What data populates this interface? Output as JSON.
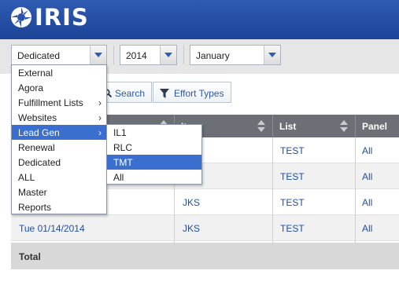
{
  "app": {
    "logo_text": "IRIS"
  },
  "filters": {
    "type": {
      "value": "Dedicated"
    },
    "year": {
      "value": "2014"
    },
    "month": {
      "value": "January"
    }
  },
  "toolbar": {
    "search_label": "Search",
    "effort_types_label": "Effort Types"
  },
  "menu": {
    "items": [
      {
        "label": "External",
        "submenu": false
      },
      {
        "label": "Agora",
        "submenu": false
      },
      {
        "label": "Fulfillment Lists",
        "submenu": true
      },
      {
        "label": "Websites",
        "submenu": true
      },
      {
        "label": "Lead Gen",
        "submenu": true,
        "highlighted": true
      },
      {
        "label": "Renewal",
        "submenu": false
      },
      {
        "label": "Dedicated",
        "submenu": false
      },
      {
        "label": "ALL",
        "submenu": false
      },
      {
        "label": "Master",
        "submenu": false
      },
      {
        "label": "Reports",
        "submenu": false
      }
    ],
    "chevron": "›"
  },
  "submenu": {
    "items": [
      {
        "label": "IL1"
      },
      {
        "label": "RLC"
      },
      {
        "label": "TMT",
        "highlighted": true
      },
      {
        "label": "All"
      }
    ]
  },
  "table": {
    "headers": {
      "item": "Item",
      "list": "List",
      "panel": "Panel"
    },
    "rows": [
      {
        "date": "",
        "item": "",
        "list": "TEST",
        "panel": "All"
      },
      {
        "date": "",
        "item": "",
        "list": "TEST",
        "panel": "All"
      },
      {
        "date": "",
        "item": "JKS",
        "list": "TEST",
        "panel": "All"
      },
      {
        "date": "Tue 01/14/2014",
        "item": "JKS",
        "list": "TEST",
        "panel": "All"
      }
    ],
    "total_label": "Total"
  },
  "colors": {
    "header_blue": "#1c4496",
    "highlight": "#3a6fd0",
    "link": "#1f4fa8",
    "table_header": "#6c6f75"
  }
}
